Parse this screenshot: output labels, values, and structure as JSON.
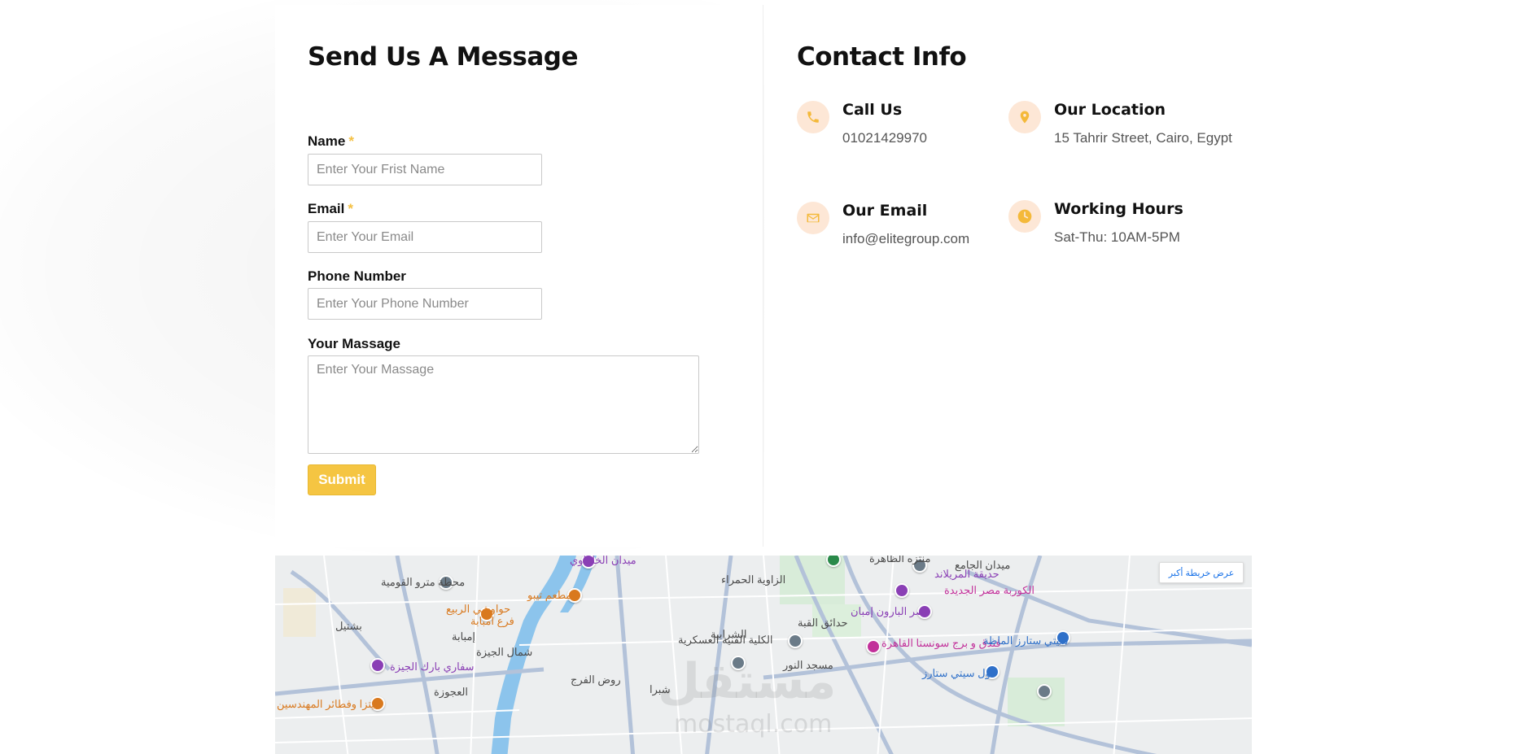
{
  "form": {
    "title": "Send Us A Message",
    "name_label": "Name",
    "name_placeholder": "Enter Your Frist Name",
    "email_label": "Email",
    "email_placeholder": "Enter Your Email",
    "phone_label": "Phone Number",
    "phone_placeholder": "Enter Your Phone Number",
    "message_label": "Your Massage",
    "message_placeholder": "Enter Your Massage",
    "required_mark": "*",
    "submit_label": "Submit"
  },
  "contact": {
    "title": "Contact Info",
    "items": [
      {
        "title": "Call Us",
        "value": "01021429970",
        "icon": "phone-icon"
      },
      {
        "title": "Our Location",
        "value": "15 Tahrir Street, Cairo, Egypt",
        "icon": "map-pin-icon"
      },
      {
        "title": "Our Email",
        "value": "info@elitegroup.com",
        "icon": "envelope-icon"
      },
      {
        "title": "Working Hours",
        "value": "Sat-Thu: 10AM-5PM",
        "icon": "clock-icon"
      }
    ]
  },
  "map": {
    "view_larger": "عرض خريطة أكبر",
    "labels": [
      "ميدان الخلفاوي",
      "منتزه الظاهرة",
      "ميدان الجامع",
      "محطة مترو القومية",
      "حواوشي الربيع",
      "فرع امبابة",
      "مطعم تيبو",
      "الزاوية الحمراء",
      "حديقة المريلاند",
      "الكوربة مصر الجديدة",
      "قصر البارون إمبان",
      "بشتيل",
      "إمبابة",
      "الشرابية",
      "حدائق القبة",
      "الكلية الفنية العسكرية",
      "شمال الجيزة",
      "سفاري بارك الجيزة",
      "روض الفرج",
      "مسجد النور",
      "فندق و برج سونستا القاهرة",
      "سيتي ستارز الماظة",
      "مول سيتي ستارز",
      "بيتزا وفطائر المهندسين",
      "شبرا",
      "العجوزة"
    ]
  },
  "colors": {
    "accent": "#f5c542",
    "icon_bg": "#fde7d6",
    "icon_fg": "#f4b93a"
  }
}
